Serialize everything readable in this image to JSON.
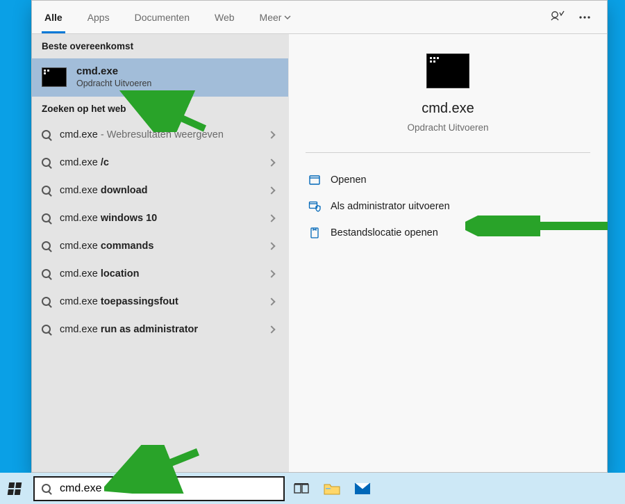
{
  "tabs": {
    "all": "Alle",
    "apps": "Apps",
    "documents": "Documenten",
    "web": "Web",
    "more": "Meer"
  },
  "sections": {
    "best_match": "Beste overeenkomst",
    "web_search": "Zoeken op het web"
  },
  "best_match": {
    "title": "cmd.exe",
    "subtitle": "Opdracht Uitvoeren"
  },
  "web_results": [
    {
      "prefix": "cmd.exe",
      "bold": "",
      "suffix": " - Webresultaten weergeven"
    },
    {
      "prefix": "cmd.exe ",
      "bold": "/c",
      "suffix": ""
    },
    {
      "prefix": "cmd.exe ",
      "bold": "download",
      "suffix": ""
    },
    {
      "prefix": "cmd.exe ",
      "bold": "windows 10",
      "suffix": ""
    },
    {
      "prefix": "cmd.exe ",
      "bold": "commands",
      "suffix": ""
    },
    {
      "prefix": "cmd.exe ",
      "bold": "location",
      "suffix": ""
    },
    {
      "prefix": "cmd.exe ",
      "bold": "toepassingsfout",
      "suffix": ""
    },
    {
      "prefix": "cmd.exe ",
      "bold": "run as administrator",
      "suffix": ""
    }
  ],
  "preview": {
    "title": "cmd.exe",
    "subtitle": "Opdracht Uitvoeren",
    "actions": {
      "open": "Openen",
      "run_admin": "Als administrator uitvoeren",
      "open_location": "Bestandslocatie openen"
    }
  },
  "taskbar": {
    "search_value": "cmd.exe"
  }
}
